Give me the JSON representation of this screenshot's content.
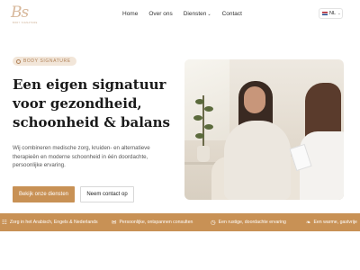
{
  "brand": {
    "logo_mark": "Bs",
    "logo_sub": "BODY SIGNATURE"
  },
  "nav": {
    "items": [
      "Home",
      "Over ons",
      "Diensten",
      "Contact"
    ],
    "dropdown_chevron": "⌄"
  },
  "language": {
    "code": "NL",
    "flag": "netherlands-flag"
  },
  "hero": {
    "badge": "BODY SIGNATURE",
    "headline": "Een eigen signatuur voor gezondheid, schoonheid & balans",
    "intro": "Wij combineren medische zorg, kruiden- en alternatieve therapieën en moderne schoonheid in één doordachte, persoonlijke ervaring.",
    "primary_button": "Bekijk onze diensten",
    "secondary_button": "Neem contact op"
  },
  "features": [
    {
      "icon": "globe-icon",
      "glyph": "☷",
      "text": "Zorg in het Arabisch, Engels & Nederlands"
    },
    {
      "icon": "chat-icon",
      "glyph": "✉",
      "text": "Persoonlijke, ontspannen consulten"
    },
    {
      "icon": "clock-icon",
      "glyph": "◷",
      "text": "Een rustige, doordachte ervaring"
    },
    {
      "icon": "leaf-icon",
      "glyph": "❧",
      "text": "Een warme, gastvrije"
    }
  ],
  "colors": {
    "accent": "#c89155",
    "badge_bg": "#f2e6d9",
    "badge_text": "#b08057",
    "logo": "#d7b79a"
  }
}
